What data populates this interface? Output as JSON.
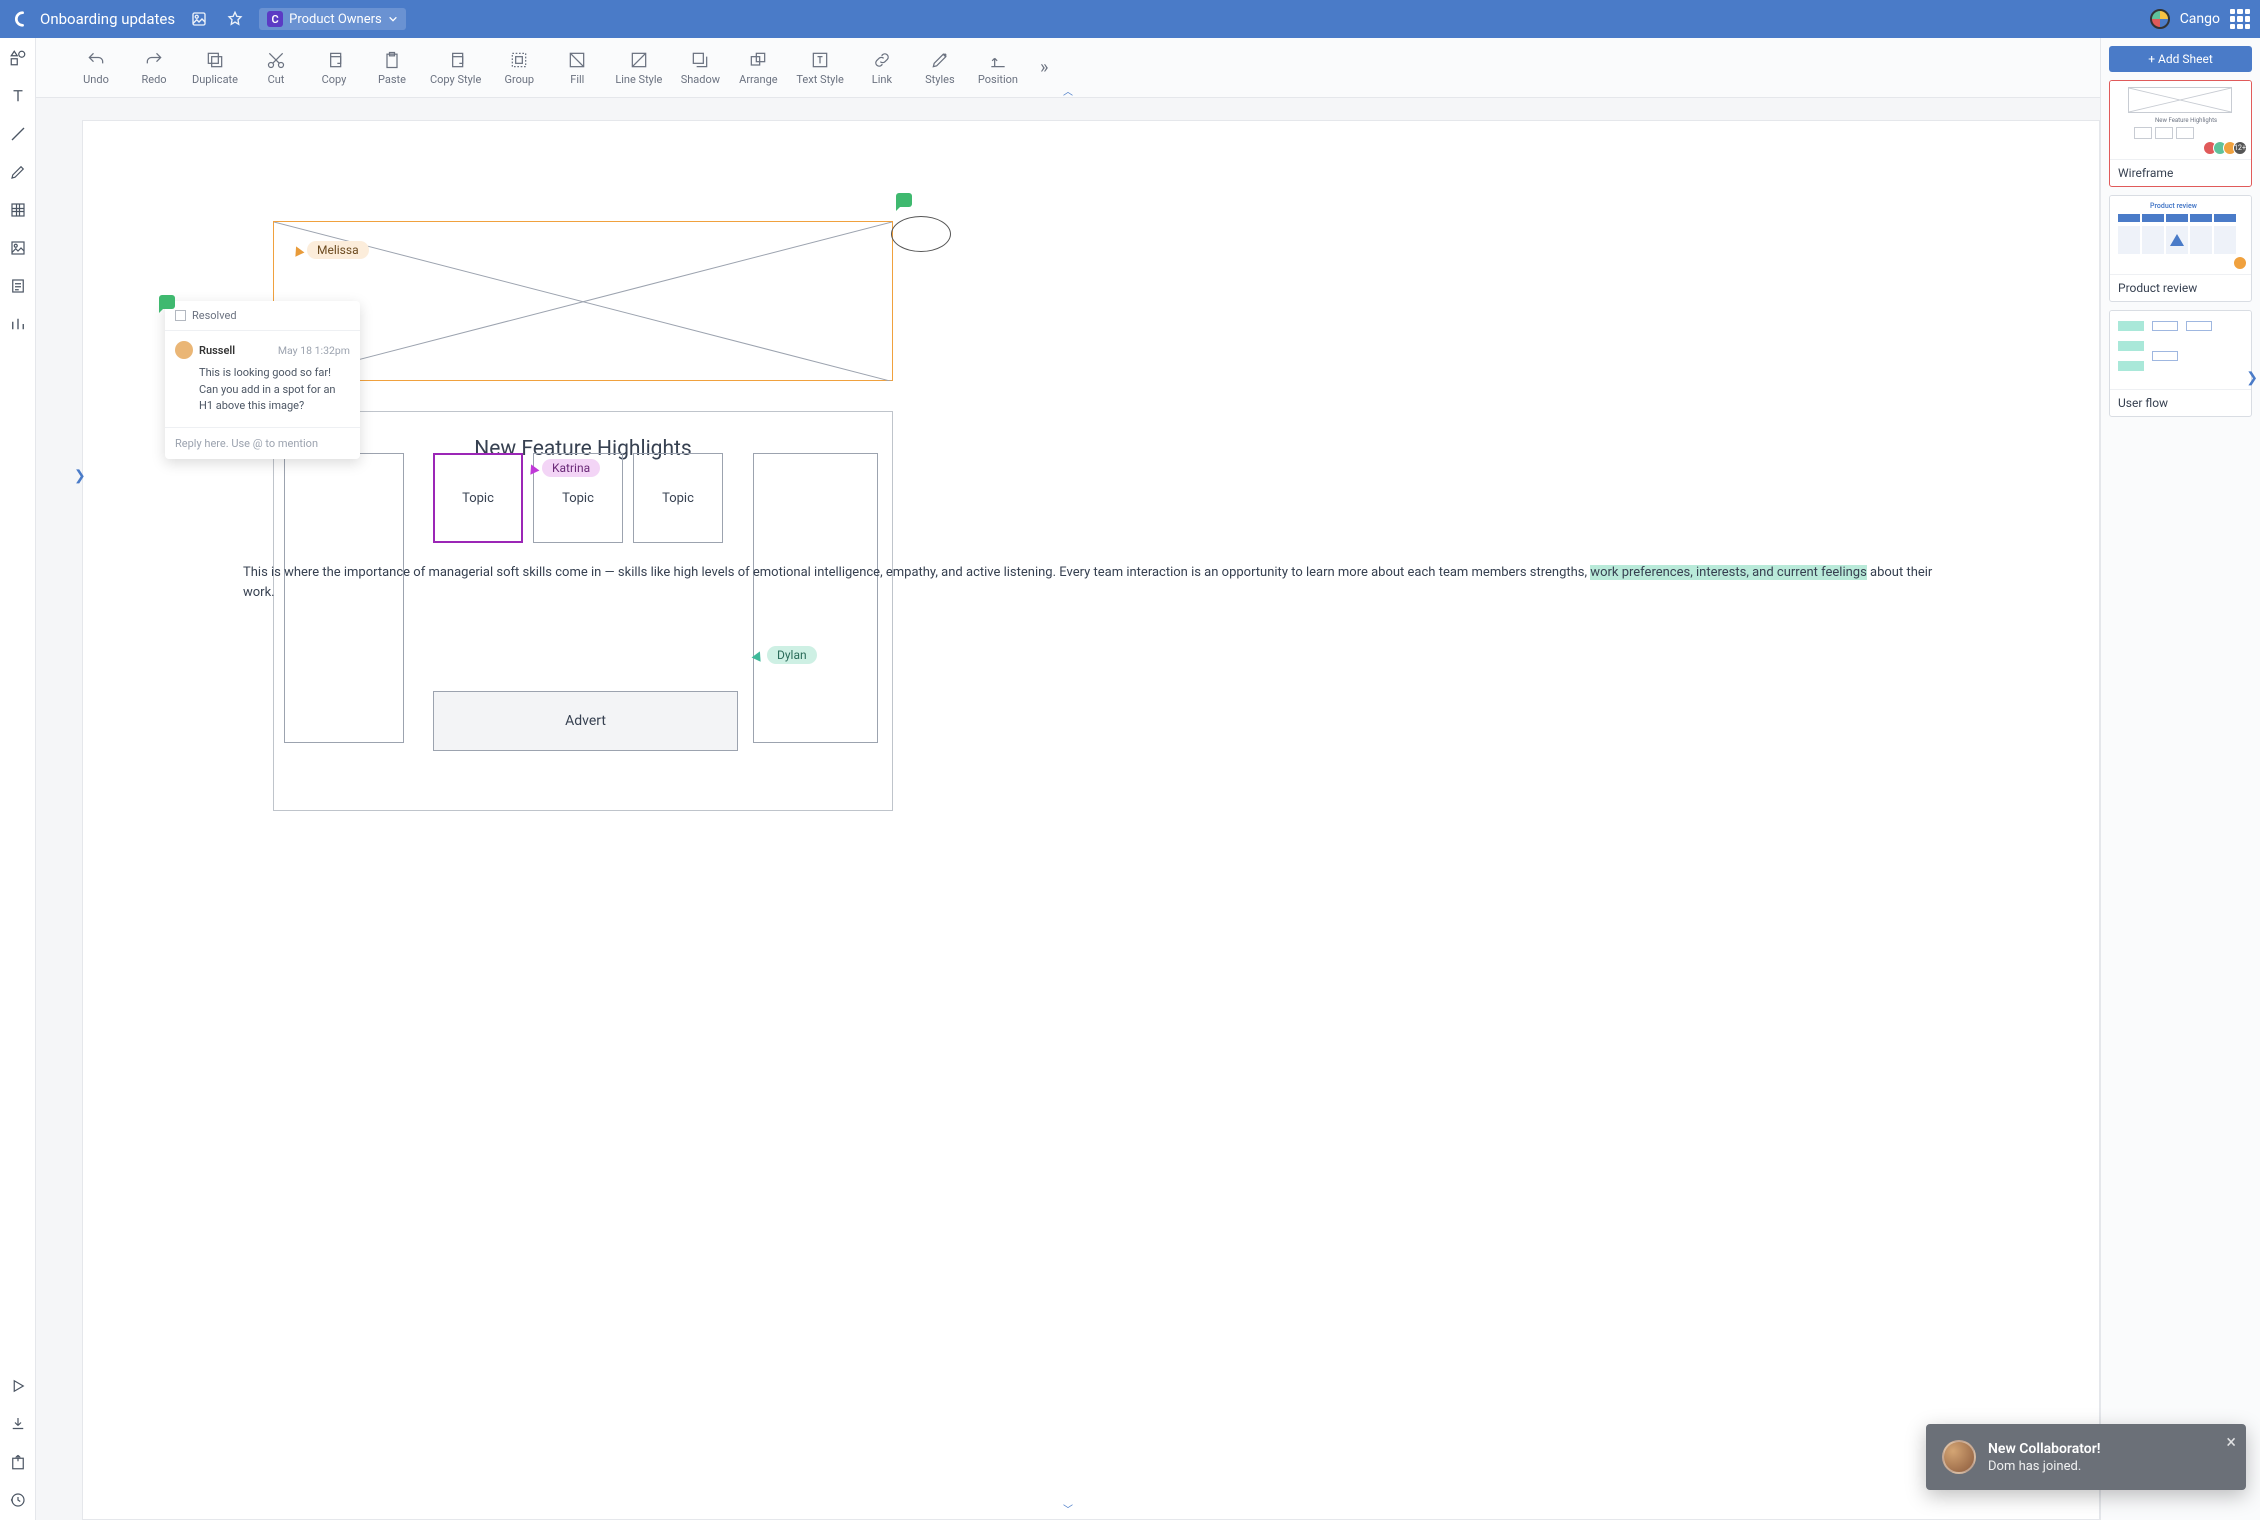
{
  "header": {
    "doc_title": "Onboarding updates",
    "team_label": "Product Owners",
    "brand_name": "Cango"
  },
  "toolbar": {
    "items": [
      "Undo",
      "Redo",
      "Duplicate",
      "Cut",
      "Copy",
      "Paste",
      "Copy Style",
      "Group",
      "Fill",
      "Line Style",
      "Shadow",
      "Arrange",
      "Text Style",
      "Link",
      "Styles",
      "Position"
    ]
  },
  "leftbar_tools": [
    "shapes",
    "text",
    "line",
    "pen",
    "grid",
    "image",
    "document",
    "chart"
  ],
  "leftbar_bottom": [
    "play",
    "download",
    "export",
    "history"
  ],
  "canvas": {
    "collaborators": {
      "melissa": "Melissa",
      "katrina": "Katrina",
      "dylan": "Dylan"
    },
    "content": {
      "title": "New Feature Highlights",
      "topics": [
        "Topic",
        "Topic",
        "Topic"
      ],
      "body_pre": "This is where the importance of managerial soft skills come in — skills like high levels of emotional intelligence, empathy, and active listening. Every team interaction is an opportunity to learn more about each team members strengths, ",
      "body_highlight": "work preferences, interests, and current feelings",
      "body_post": " about their work.",
      "advert_label": "Advert"
    }
  },
  "comment": {
    "resolved_label": "Resolved",
    "author": "Russell",
    "timestamp": "May 18 1:32pm",
    "message": "This is looking good so far! Can you add in a spot for an H1 above this image?",
    "reply_placeholder": "Reply here. Use @ to mention"
  },
  "sheets": {
    "add_label": "+ Add Sheet",
    "items": [
      {
        "label": "Wireframe",
        "active": true,
        "avatar_overflow": "12+"
      },
      {
        "label": "Product review",
        "active": false,
        "title_text": "Product review"
      },
      {
        "label": "User flow",
        "active": false
      }
    ]
  },
  "toast": {
    "title": "New Collaborator!",
    "message": "Dom has joined."
  },
  "colors": {
    "primary": "#4a7bc8",
    "melissa": "#f0a13e",
    "katrina": "#9b26b6",
    "dylan": "#3fb99a",
    "comment_green": "#3fb96f"
  }
}
